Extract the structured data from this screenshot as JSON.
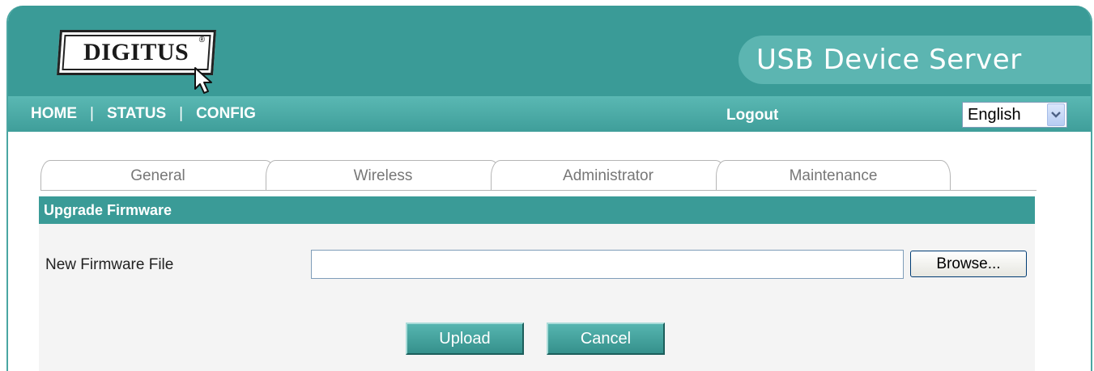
{
  "header": {
    "logo_text": "DIGITUS",
    "logo_mark": "®",
    "product_title": "USB Device Server"
  },
  "nav": {
    "home": "HOME",
    "status": "STATUS",
    "config": "CONFIG",
    "separator": "|",
    "logout": "Logout",
    "language": "English"
  },
  "tabs": [
    "General",
    "Wireless",
    "Administrator",
    "Maintenance"
  ],
  "section": {
    "title": "Upgrade Firmware",
    "field_label": "New Firmware File",
    "file_value": "",
    "browse_label": "Browse...",
    "upload_label": "Upload",
    "cancel_label": "Cancel"
  },
  "colors": {
    "header_teal": "#3a9b97",
    "title_pill": "#5cb5b1",
    "nav_teal": "#4aaaa6"
  },
  "icons": {
    "logo_cursor": "cursor-arrow-icon",
    "language_dropdown": "chevron-down-icon"
  }
}
